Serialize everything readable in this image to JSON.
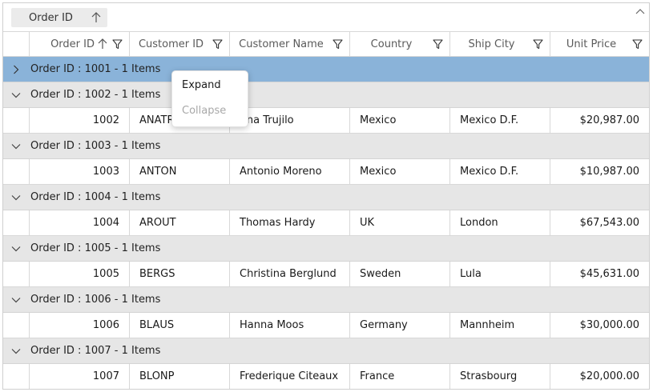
{
  "group_bar": {
    "chip_label": "Order ID"
  },
  "columns": [
    {
      "label": "Order ID"
    },
    {
      "label": "Customer ID"
    },
    {
      "label": "Customer Name"
    },
    {
      "label": "Country"
    },
    {
      "label": "Ship City"
    },
    {
      "label": "Unit Price"
    }
  ],
  "groups": [
    {
      "caption": "Order ID : 1001 - 1 Items",
      "selected": true,
      "expanded": false,
      "rows": []
    },
    {
      "caption": "Order ID : 1002 - 1 Items",
      "expanded": true,
      "rows": [
        {
          "order_id": "1002",
          "customer_id": "ANATR",
          "customer_name": "Ana Trujilo",
          "country": "Mexico",
          "ship_city": "Mexico D.F.",
          "unit_price": "$20,987.00"
        }
      ]
    },
    {
      "caption": "Order ID : 1003 - 1 Items",
      "expanded": true,
      "rows": [
        {
          "order_id": "1003",
          "customer_id": "ANTON",
          "customer_name": "Antonio Moreno",
          "country": "Mexico",
          "ship_city": "Mexico D.F.",
          "unit_price": "$10,987.00"
        }
      ]
    },
    {
      "caption": "Order ID : 1004 - 1 Items",
      "expanded": true,
      "rows": [
        {
          "order_id": "1004",
          "customer_id": "AROUT",
          "customer_name": "Thomas Hardy",
          "country": "UK",
          "ship_city": "London",
          "unit_price": "$67,543.00"
        }
      ]
    },
    {
      "caption": "Order ID : 1005 - 1 Items",
      "expanded": true,
      "rows": [
        {
          "order_id": "1005",
          "customer_id": "BERGS",
          "customer_name": "Christina Berglund",
          "country": "Sweden",
          "ship_city": "Lula",
          "unit_price": "$45,631.00"
        }
      ]
    },
    {
      "caption": "Order ID : 1006 - 1 Items",
      "expanded": true,
      "rows": [
        {
          "order_id": "1006",
          "customer_id": "BLAUS",
          "customer_name": "Hanna Moos",
          "country": "Germany",
          "ship_city": "Mannheim",
          "unit_price": "$30,000.00"
        }
      ]
    },
    {
      "caption": "Order ID : 1007 - 1 Items",
      "expanded": true,
      "rows": [
        {
          "order_id": "1007",
          "customer_id": "BLONP",
          "customer_name": "Frederique Citeaux",
          "country": "France",
          "ship_city": "Strasbourg",
          "unit_price": "$20,000.00"
        }
      ]
    }
  ],
  "context_menu": {
    "expand_label": "Expand",
    "collapse_label": "Collapse"
  },
  "colors": {
    "selected_group": "#8ab3d9",
    "group_row": "#e6e6e6",
    "disabled_text": "#a8a8a8"
  }
}
